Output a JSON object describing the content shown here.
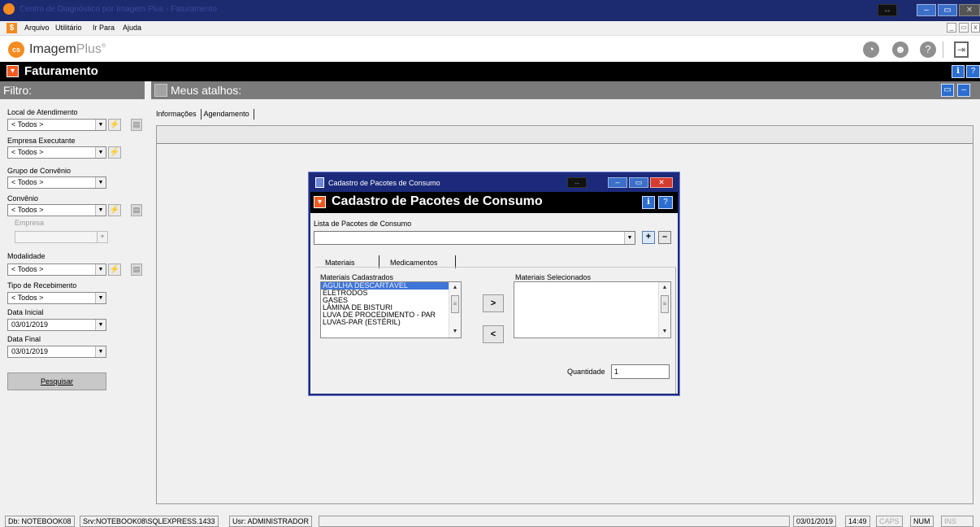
{
  "window": {
    "title": "Centro de Diagnóstico por Imagem Plus - Faturamento",
    "controls": {
      "move": "↔",
      "minimize": "–",
      "maximize": "▭",
      "close": "✕"
    }
  },
  "menu": {
    "app_icon": "$",
    "items": [
      "Arquivo",
      "Utilitário",
      "Ir Para",
      "Ajuda"
    ],
    "mdi_controls": {
      "minimize": "_",
      "restore": "▭",
      "close": "x"
    }
  },
  "brand": {
    "logo_text": "cs",
    "name": "Imagem",
    "plus": "Plus",
    "mark": "®",
    "icons": [
      "globe-icon",
      "support-agent-icon",
      "help-icon",
      "exit-icon"
    ],
    "icon_glyphs": {
      "globe": "◔",
      "support": "☻",
      "help": "?",
      "exit": "⇥"
    }
  },
  "module": {
    "title": "Faturamento",
    "icon": "▾",
    "buttons": {
      "info": "ℹ",
      "help": "?"
    }
  },
  "filter": {
    "header": "Filtro:",
    "fields": [
      {
        "label": "Local de Atendimento",
        "value": "< Todos >"
      },
      {
        "label": "Empresa Executante",
        "value": "< Todos >"
      },
      {
        "label": "Grupo de Convênio",
        "value": "< Todos >"
      },
      {
        "label": "Convênio",
        "value": "< Todos >"
      },
      {
        "label": "Empresa",
        "value": ""
      },
      {
        "label": "Modalidade",
        "value": "< Todos >"
      },
      {
        "label": "Tipo de Recebimento",
        "value": "< Todos >"
      },
      {
        "label": "Data Inicial",
        "value": "03/01/2019"
      },
      {
        "label": "Data Final",
        "value": "03/01/2019"
      }
    ],
    "search_button": "Pesquisar",
    "lightning_icon": "⚡",
    "grid_icon": "▤",
    "arrow": "▼"
  },
  "shortcuts": {
    "header": "Meus atalhos:",
    "buttons": {
      "restore": "▭",
      "minimize": "–"
    }
  },
  "content_tabs": [
    "Informações",
    "Agendamento"
  ],
  "dialog": {
    "window_title": "Cadastro de Pacotes de Consumo",
    "header_title": "Cadastro de Pacotes de Consumo",
    "controls": {
      "move": "↔",
      "minimize": "–",
      "maximize": "▭",
      "close": "✕",
      "info": "ℹ",
      "help": "?"
    },
    "list_label": "Lista de Pacotes de Consumo",
    "list_value": "",
    "add_button": "+",
    "remove_button": "–",
    "tabs": [
      "Materiais",
      "Medicamentos"
    ],
    "registered_label": "Materiais Cadastrados",
    "registered_items": [
      "AGULHA DESCARTÁVEL",
      "ELETRODOS",
      "GASES",
      "LÂMINA DE BISTURI",
      "LUVA DE PROCEDIMENTO - PAR",
      "LUVAS-PAR (ESTÉRIL)"
    ],
    "selected_label": "Materiais Selecionados",
    "selected_items": [],
    "move_right": ">",
    "move_left": "<",
    "quantity_label": "Quantidade",
    "quantity_value": "1",
    "scroll": {
      "up": "▲",
      "down": "▼",
      "thumb": "≡"
    }
  },
  "status": {
    "db": "Db: NOTEBOOK08",
    "server": "Srv:NOTEBOOK08\\SQLEXPRESS.1433",
    "user": "Usr: ADMINISTRADOR",
    "message": "",
    "date": "03/01/2019",
    "time": "14:49",
    "caps": "CAPS",
    "num": "NUM",
    "ins": "INS"
  }
}
